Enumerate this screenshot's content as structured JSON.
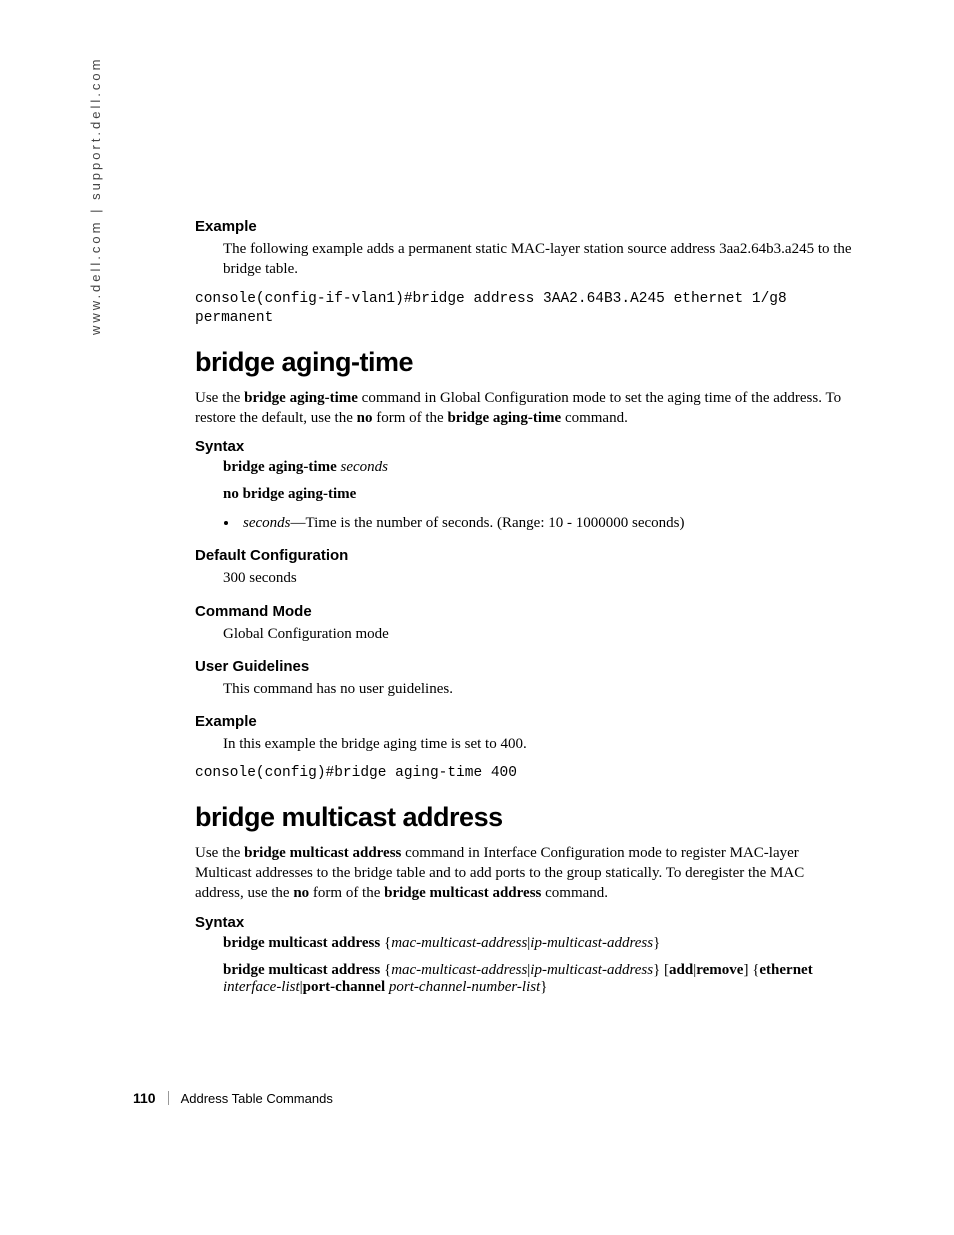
{
  "side_url": "www.dell.com | support.dell.com",
  "sec1": {
    "example_head": "Example",
    "example_text": "The following example adds a permanent static MAC-layer station source address 3aa2.64b3.a245 to the bridge table.",
    "code": "console(config-if-vlan1)#bridge address 3AA2.64B3.A245 ethernet 1/g8 permanent"
  },
  "cmd1": {
    "title": "bridge aging-time",
    "intro_pre": "Use the ",
    "intro_bold1": "bridge aging-time",
    "intro_mid": " command in Global Configuration mode to set the aging time of the address. To restore the default, use the ",
    "intro_bold2": "no",
    "intro_mid2": " form of the ",
    "intro_bold3": "bridge aging-time",
    "intro_post": " command.",
    "syntax_head": "Syntax",
    "syntax_l1_bold": "bridge aging-time",
    "syntax_l1_ital": "seconds",
    "syntax_l2": "no bridge aging-time",
    "bullet_ital": "seconds",
    "bullet_rest": "—Time is the number of seconds. (Range: 10 - 1000000 seconds)",
    "defcfg_head": "Default Configuration",
    "defcfg_text": "300 seconds",
    "cmdmode_head": "Command Mode",
    "cmdmode_text": "Global Configuration mode",
    "ug_head": "User Guidelines",
    "ug_text": "This command has no user guidelines.",
    "ex_head": "Example",
    "ex_text": "In this example the bridge aging time is set to 400.",
    "ex_code": "console(config)#bridge aging-time 400"
  },
  "cmd2": {
    "title": "bridge multicast address",
    "intro_pre": "Use the ",
    "intro_bold1": "bridge multicast address",
    "intro_mid": " command in Interface Configuration mode to register MAC-layer Multicast addresses to the bridge table and to add ports to the group statically. To deregister the MAC address, use the ",
    "intro_bold2": "no",
    "intro_mid2": " form of the ",
    "intro_bold3": "bridge multicast address",
    "intro_post": " command.",
    "syntax_head": "Syntax",
    "s1_b1": "bridge multicast address",
    "s1_brace_o": " {",
    "s1_i1": "mac-multicast-address",
    "s1_pipe": "|",
    "s1_i2": "ip-multicast-address",
    "s1_brace_c": "}",
    "s2_b1": "bridge multicast address",
    "s2_brace_o": " {",
    "s2_i1": "mac-multicast-address",
    "s2_pipe1": "|",
    "s2_i2": "ip-multicast-address",
    "s2_brace_c": "}",
    "s2_sq_o": " [",
    "s2_b2": "add",
    "s2_pipe2": "|",
    "s2_b3": "remove",
    "s2_sq_c": "] ",
    "s2_brace2_o": "{",
    "s2_b4": "ethernet",
    "s2_sp1": " ",
    "s2_i3": "interface-list",
    "s2_pipe3": "|",
    "s2_b5": "port-channel",
    "s2_sp2": " ",
    "s2_i4": "port-channel-number-list",
    "s2_brace2_c": "}"
  },
  "footer": {
    "page": "110",
    "section": "Address Table Commands"
  }
}
